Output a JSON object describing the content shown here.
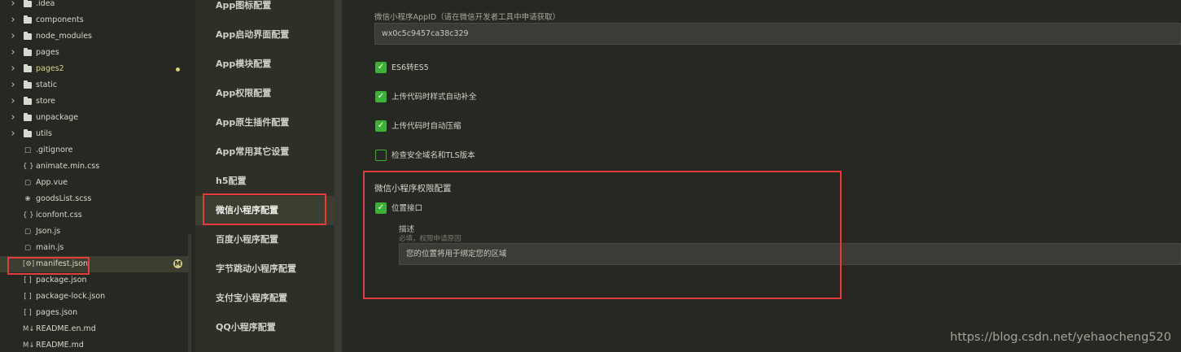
{
  "file_tree": [
    {
      "type": "folder",
      "name": ".idea"
    },
    {
      "type": "folder",
      "name": "components"
    },
    {
      "type": "folder",
      "name": "node_modules"
    },
    {
      "type": "folder",
      "name": "pages"
    },
    {
      "type": "folder",
      "name": "pages2",
      "modified": true
    },
    {
      "type": "folder",
      "name": "static"
    },
    {
      "type": "folder",
      "name": "store"
    },
    {
      "type": "folder",
      "name": "unpackage"
    },
    {
      "type": "folder",
      "name": "utils"
    },
    {
      "type": "file",
      "icon": "□",
      "icon_name": "file-icon",
      "name": ".gitignore"
    },
    {
      "type": "file",
      "icon": "{ }",
      "icon_name": "css-file-icon",
      "name": "animate.min.css"
    },
    {
      "type": "file",
      "icon": "▢",
      "icon_name": "vue-file-icon",
      "name": "App.vue"
    },
    {
      "type": "file",
      "icon": "❀",
      "icon_name": "scss-file-icon",
      "name": "goodsList.scss"
    },
    {
      "type": "file",
      "icon": "{ }",
      "icon_name": "css-file-icon",
      "name": "iconfont.css"
    },
    {
      "type": "file",
      "icon": "▢",
      "icon_name": "js-file-icon",
      "name": "Json.js"
    },
    {
      "type": "file",
      "icon": "▢",
      "icon_name": "js-file-icon",
      "name": "main.js"
    },
    {
      "type": "file",
      "icon": "[⚙]",
      "icon_name": "manifest-file-icon",
      "name": "manifest.json",
      "active": true,
      "badge": "M"
    },
    {
      "type": "file",
      "icon": "[ ]",
      "icon_name": "json-file-icon",
      "name": "package.json"
    },
    {
      "type": "file",
      "icon": "[ ]",
      "icon_name": "json-file-icon",
      "name": "package-lock.json"
    },
    {
      "type": "file",
      "icon": "[ ]",
      "icon_name": "json-file-icon",
      "name": "pages.json"
    },
    {
      "type": "file",
      "icon": "M↓",
      "icon_name": "markdown-file-icon",
      "name": "README.en.md"
    },
    {
      "type": "file",
      "icon": "M↓",
      "icon_name": "markdown-file-icon",
      "name": "README.md"
    }
  ],
  "config_nav": [
    {
      "label": "App图标配置"
    },
    {
      "label": "App启动界面配置"
    },
    {
      "label": "App模块配置"
    },
    {
      "label": "App权限配置"
    },
    {
      "label": "App原生插件配置"
    },
    {
      "label": "App常用其它设置"
    },
    {
      "label": "h5配置"
    },
    {
      "label": "微信小程序配置",
      "active": true
    },
    {
      "label": "百度小程序配置"
    },
    {
      "label": "字节跳动小程序配置"
    },
    {
      "label": "支付宝小程序配置"
    },
    {
      "label": "QQ小程序配置"
    }
  ],
  "settings": {
    "appid_label": "微信小程序AppID（请在微信开发者工具中申请获取）",
    "appid_value": "wx0c5c9457ca38c329",
    "checkboxes": [
      {
        "label": "ES6转ES5",
        "checked": true
      },
      {
        "label": "上传代码时样式自动补全",
        "checked": true
      },
      {
        "label": "上传代码时自动压缩",
        "checked": true
      },
      {
        "label": "检查安全域名和TLS版本",
        "checked": false
      }
    ],
    "permission": {
      "title": "微信小程序权限配置",
      "location_label": "位置接口",
      "location_checked": true,
      "desc_label": "描述",
      "desc_hint": "必填，权限申请原因",
      "desc_value": "您的位置将用于绑定您的区域"
    }
  },
  "watermark": "https://blog.csdn.net/yehaocheng520",
  "colors": {
    "highlight_box": "#e23c3c",
    "checkbox_green": "#3eaf3a",
    "modified_yellow": "#dcd18b"
  }
}
